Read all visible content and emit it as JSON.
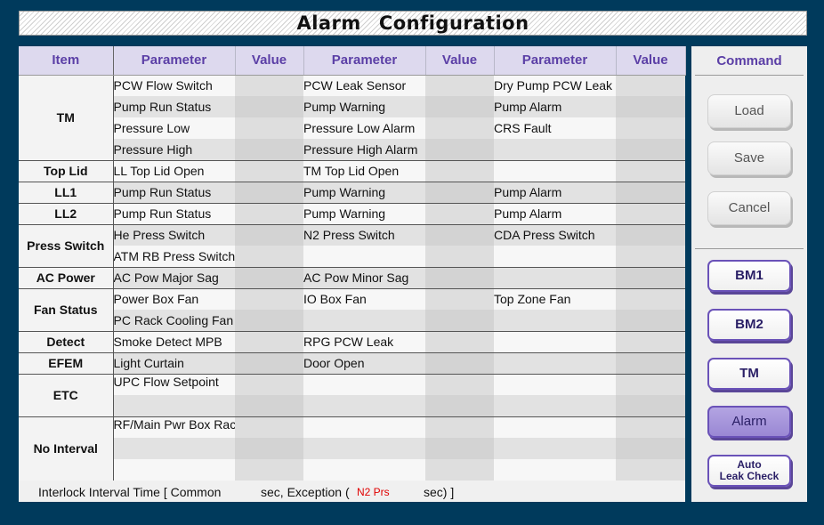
{
  "title": {
    "word1": "Alarm",
    "word2": "Configuration"
  },
  "headers": {
    "item": "Item",
    "parameter": "Parameter",
    "value": "Value"
  },
  "rows": [
    {
      "item": "TM",
      "p1": "PCW Flow Switch",
      "p2": "PCW Leak Sensor",
      "p3": "Dry Pump PCW Leak"
    },
    {
      "p1": "Pump Run Status",
      "p2": "Pump Warning",
      "p3": "Pump Alarm"
    },
    {
      "p1": "Pressure Low",
      "p2": "Pressure Low Alarm",
      "p3": "CRS Fault"
    },
    {
      "p1": "Pressure High",
      "p2": "Pressure High Alarm",
      "p3": ""
    },
    {
      "item": "Top Lid",
      "p1": "LL Top Lid Open",
      "p2": "TM Top Lid Open",
      "p3": ""
    },
    {
      "item": "LL1",
      "p1": "Pump Run Status",
      "p2": "Pump Warning",
      "p3": "Pump Alarm"
    },
    {
      "item": "LL2",
      "p1": "Pump Run Status",
      "p2": "Pump Warning",
      "p3": "Pump Alarm"
    },
    {
      "item": "Press Switch",
      "p1": "He Press Switch",
      "p2": "N2 Press Switch",
      "p3": "CDA Press Switch"
    },
    {
      "p1": "ATM RB Press Switch",
      "p2": "",
      "p3": ""
    },
    {
      "item": "AC Power",
      "p1": "AC Pow Major Sag",
      "p2": "AC Pow Minor Sag",
      "p3": ""
    },
    {
      "item": "Fan Status",
      "p1": "Power Box Fan",
      "p2": "IO Box Fan",
      "p3": "Top Zone Fan"
    },
    {
      "p1": "PC Rack Cooling Fan",
      "p2": "",
      "p3": ""
    },
    {
      "item": "Detect",
      "p1": "Smoke Detect MPB",
      "p2": "RPG PCW Leak",
      "p3": ""
    },
    {
      "item": "EFEM",
      "p1": "Light Curtain",
      "p2": "Door Open",
      "p3": ""
    },
    {
      "item": "ETC",
      "p1": "UPC Flow Setpoint",
      "p2": "",
      "p3": ""
    },
    {
      "p1": "",
      "p2": "",
      "p3": ""
    },
    {
      "item": "No Interval",
      "p1": "RF/Main Pwr Box Rack",
      "p2": "",
      "p3": ""
    },
    {
      "p1": "",
      "p2": "",
      "p3": ""
    },
    {
      "p1": "",
      "p2": "",
      "p3": ""
    }
  ],
  "footer": {
    "part1": "Interlock Interval Time [ Common",
    "part2": "sec,  Exception (",
    "part3": "N2 Prs",
    "part4": "sec) ]"
  },
  "command": {
    "header": "Command",
    "load": "Load",
    "save": "Save",
    "cancel": "Cancel",
    "bm1": "BM1",
    "bm2": "BM2",
    "tm": "TM",
    "alarm": "Alarm",
    "auto_leak_line1": "Auto",
    "auto_leak_line2": "Leak Check"
  },
  "colors": {
    "background": "#003a5c",
    "header_text": "#5b3fa6",
    "alert_text": "#e00000",
    "active_button": "#9a88d4"
  }
}
